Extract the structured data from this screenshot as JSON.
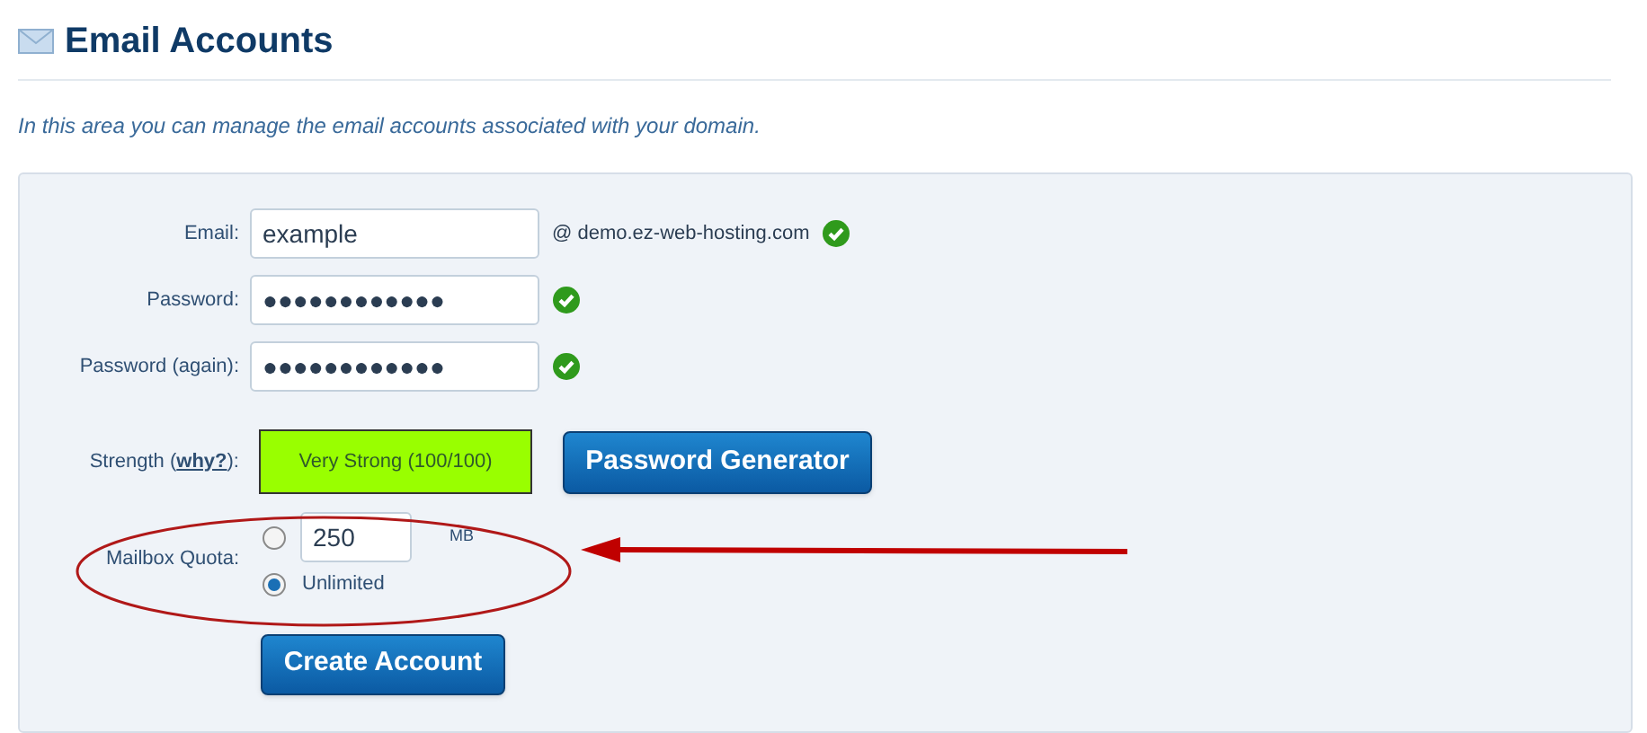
{
  "page": {
    "title": "Email Accounts",
    "description": "In this area you can manage the email accounts associated with your domain."
  },
  "form": {
    "fields": [
      {
        "label": "Email:",
        "value": "example",
        "suffix": "@ demo.ez-web-hosting.com",
        "valid": true
      },
      {
        "label": "Password:",
        "value": "●●●●●●●●●●●●",
        "valid": true
      },
      {
        "label": "Password (again):",
        "value": "●●●●●●●●●●●●",
        "valid": true
      }
    ],
    "strength": {
      "label_before": "Strength (",
      "link": "why?",
      "label_after": "):",
      "reading": "Very Strong (100/100)"
    },
    "generator_button": "Password Generator",
    "quota": {
      "label": "Mailbox Quota:",
      "options": [
        {
          "kind": "amount",
          "value": "250",
          "unit": "MB",
          "selected": false
        },
        {
          "kind": "unlimited",
          "label": "Unlimited",
          "selected": true
        }
      ]
    },
    "submit_button": "Create Account"
  }
}
